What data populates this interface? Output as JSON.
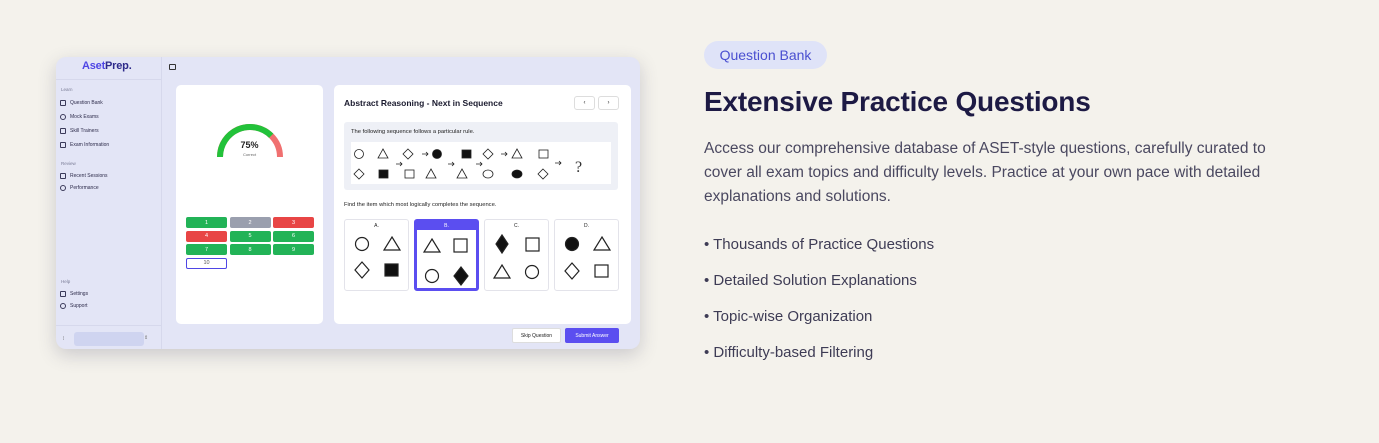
{
  "app": {
    "logo_part1": "Aset",
    "logo_part2": "Prep.",
    "sidebar": {
      "learn_label": "Learn",
      "review_label": "Review",
      "help_label": "Help",
      "learn_items": [
        "Question Bank",
        "Mock Exams",
        "Skill Trainers",
        "Exam Information"
      ],
      "review_items": [
        "Recent Sessions",
        "Performance"
      ],
      "help_items": [
        "Settings",
        "Support"
      ]
    },
    "score": {
      "percent_text": "75%",
      "percent_value": 75,
      "sub_label": "Correct"
    },
    "question_nav": [
      {
        "label": "1",
        "status": "correct"
      },
      {
        "label": "2",
        "status": "skipped"
      },
      {
        "label": "3",
        "status": "wrong"
      },
      {
        "label": "4",
        "status": "wrong"
      },
      {
        "label": "5",
        "status": "correct"
      },
      {
        "label": "6",
        "status": "correct"
      },
      {
        "label": "7",
        "status": "correct"
      },
      {
        "label": "8",
        "status": "correct"
      },
      {
        "label": "9",
        "status": "correct"
      },
      {
        "label": "10",
        "status": "current"
      }
    ],
    "question": {
      "title": "Abstract Reasoning - Next in Sequence",
      "prev_icon": "‹",
      "next_icon": "›",
      "rule_text": "The following sequence follows a particular rule.",
      "find_text": "Find the item which most logically completes the sequence.",
      "options": [
        {
          "label": "A."
        },
        {
          "label": "B."
        },
        {
          "label": "C."
        },
        {
          "label": "D."
        }
      ],
      "selected_option": "B.",
      "skip_label": "Skip Question",
      "submit_label": "Submit Answer"
    },
    "colors": {
      "accent": "#5b4ef0",
      "correct": "#22b357",
      "wrong": "#e84545",
      "skipped": "#9a9fae"
    }
  },
  "panel": {
    "badge": "Question Bank",
    "headline": "Extensive Practice Questions",
    "description": "Access our comprehensive database of ASET-style questions, carefully curated to cover all exam topics and difficulty levels. Practice at your own pace with detailed explanations and solutions.",
    "features": [
      "• Thousands of Practice Questions",
      "• Detailed Solution Explanations",
      "• Topic-wise Organization",
      "• Difficulty-based Filtering"
    ]
  }
}
